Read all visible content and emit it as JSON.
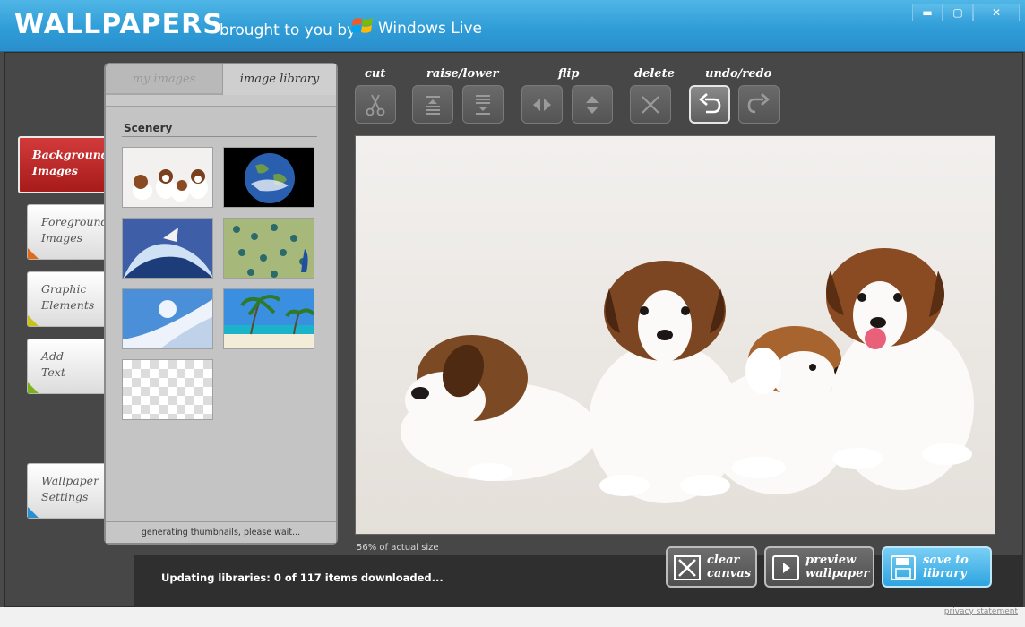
{
  "titlebar": {
    "title": "WALLPAPERS",
    "subtitle": "brought to you by",
    "brand": "Windows Live",
    "controls": {
      "minimize": "▬",
      "maximize": "▢",
      "close": "✕"
    }
  },
  "sidebar": {
    "items": [
      {
        "label_line1": "Background",
        "label_line2": "Images",
        "active": true,
        "accent": "#cc2b2b"
      },
      {
        "label_line1": "Foreground",
        "label_line2": "Images",
        "accent": "#e26a1b"
      },
      {
        "label_line1": "Graphic",
        "label_line2": "Elements",
        "accent": "#c9c21b"
      },
      {
        "label_line1": "Add",
        "label_line2": "Text",
        "accent": "#7ab317"
      },
      {
        "label_line1": "Wallpaper",
        "label_line2": "Settings",
        "accent": "#2a8fd0"
      }
    ]
  },
  "library": {
    "tabs": [
      {
        "label": "my images",
        "active": false
      },
      {
        "label": "image library",
        "active": true
      }
    ],
    "section": "Scenery",
    "thumbnails": [
      "puppies",
      "earth",
      "surfer",
      "peacock-feathers",
      "snow-mountain",
      "tropical-beach",
      "empty"
    ],
    "status": "generating thumbnails, please wait..."
  },
  "toolbar": {
    "groups": [
      {
        "label": "cut"
      },
      {
        "label": "raise/lower"
      },
      {
        "label": "flip"
      },
      {
        "label": "delete"
      },
      {
        "label": "undo/redo"
      }
    ]
  },
  "canvas": {
    "size_readout": "56% of actual size"
  },
  "status": {
    "text": "Updating libraries: 0 of 117 items downloaded..."
  },
  "actions": {
    "clear": {
      "line1": "clear",
      "line2": "canvas"
    },
    "preview": {
      "line1": "preview",
      "line2": "wallpaper"
    },
    "save": {
      "line1": "save to",
      "line2": "library"
    }
  },
  "footer": {
    "privacy": "privacy statement"
  },
  "colors": {
    "accent_blue": "#2e9bd6",
    "active_tab": "#c22a2a"
  }
}
